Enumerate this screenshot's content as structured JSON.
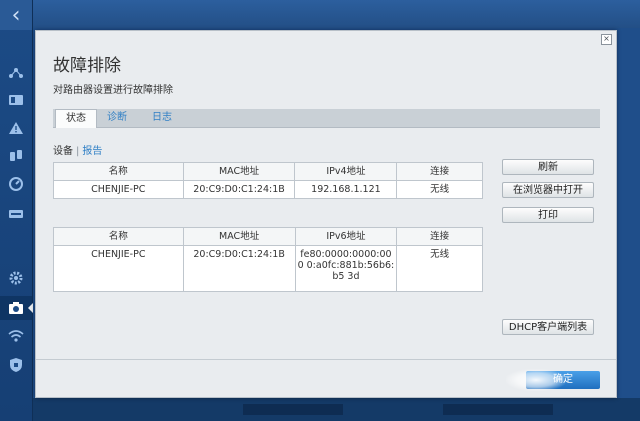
{
  "nav": {
    "back_icon": "chevron-left-icon",
    "items": [
      "network-map-icon",
      "devices-icon",
      "alert-icon",
      "parental-icon",
      "speed-icon",
      "media-icon",
      "settings-icon",
      "troubleshooting-icon",
      "wifi-icon",
      "security-icon"
    ]
  },
  "dialog": {
    "title": "故障排除",
    "subtitle": "对路由器设置进行故障排除",
    "tabs": [
      {
        "label": "状态"
      },
      {
        "label": "诊断"
      },
      {
        "label": "日志"
      }
    ],
    "crumbs": {
      "devices": "设备",
      "reports": "报告"
    },
    "ipv4_table": {
      "headers": [
        "名称",
        "MAC地址",
        "IPv4地址",
        "连接"
      ],
      "rows": [
        [
          "CHENJIE-PC",
          "20:C9:D0:C1:24:1B",
          "192.168.1.121",
          "无线"
        ]
      ]
    },
    "ipv6_table": {
      "headers": [
        "名称",
        "MAC地址",
        "IPv6地址",
        "连接"
      ],
      "rows": [
        [
          "CHENJIE-PC",
          "20:C9:D0:C1:24:1B",
          "fe80:0000:0000:000 0:a0fc:881b:56b6:b5 3d",
          "无线"
        ]
      ]
    },
    "buttons": {
      "refresh": "刷新",
      "open_in_browser": "在浏览器中打开",
      "print": "打印",
      "dhcp_list": "DHCP客户端列表",
      "ok": "确定"
    }
  },
  "colors": {
    "accent": "#2f7fc5",
    "rail": "#1c4b86",
    "dialog_bg": "#e9ecef"
  }
}
